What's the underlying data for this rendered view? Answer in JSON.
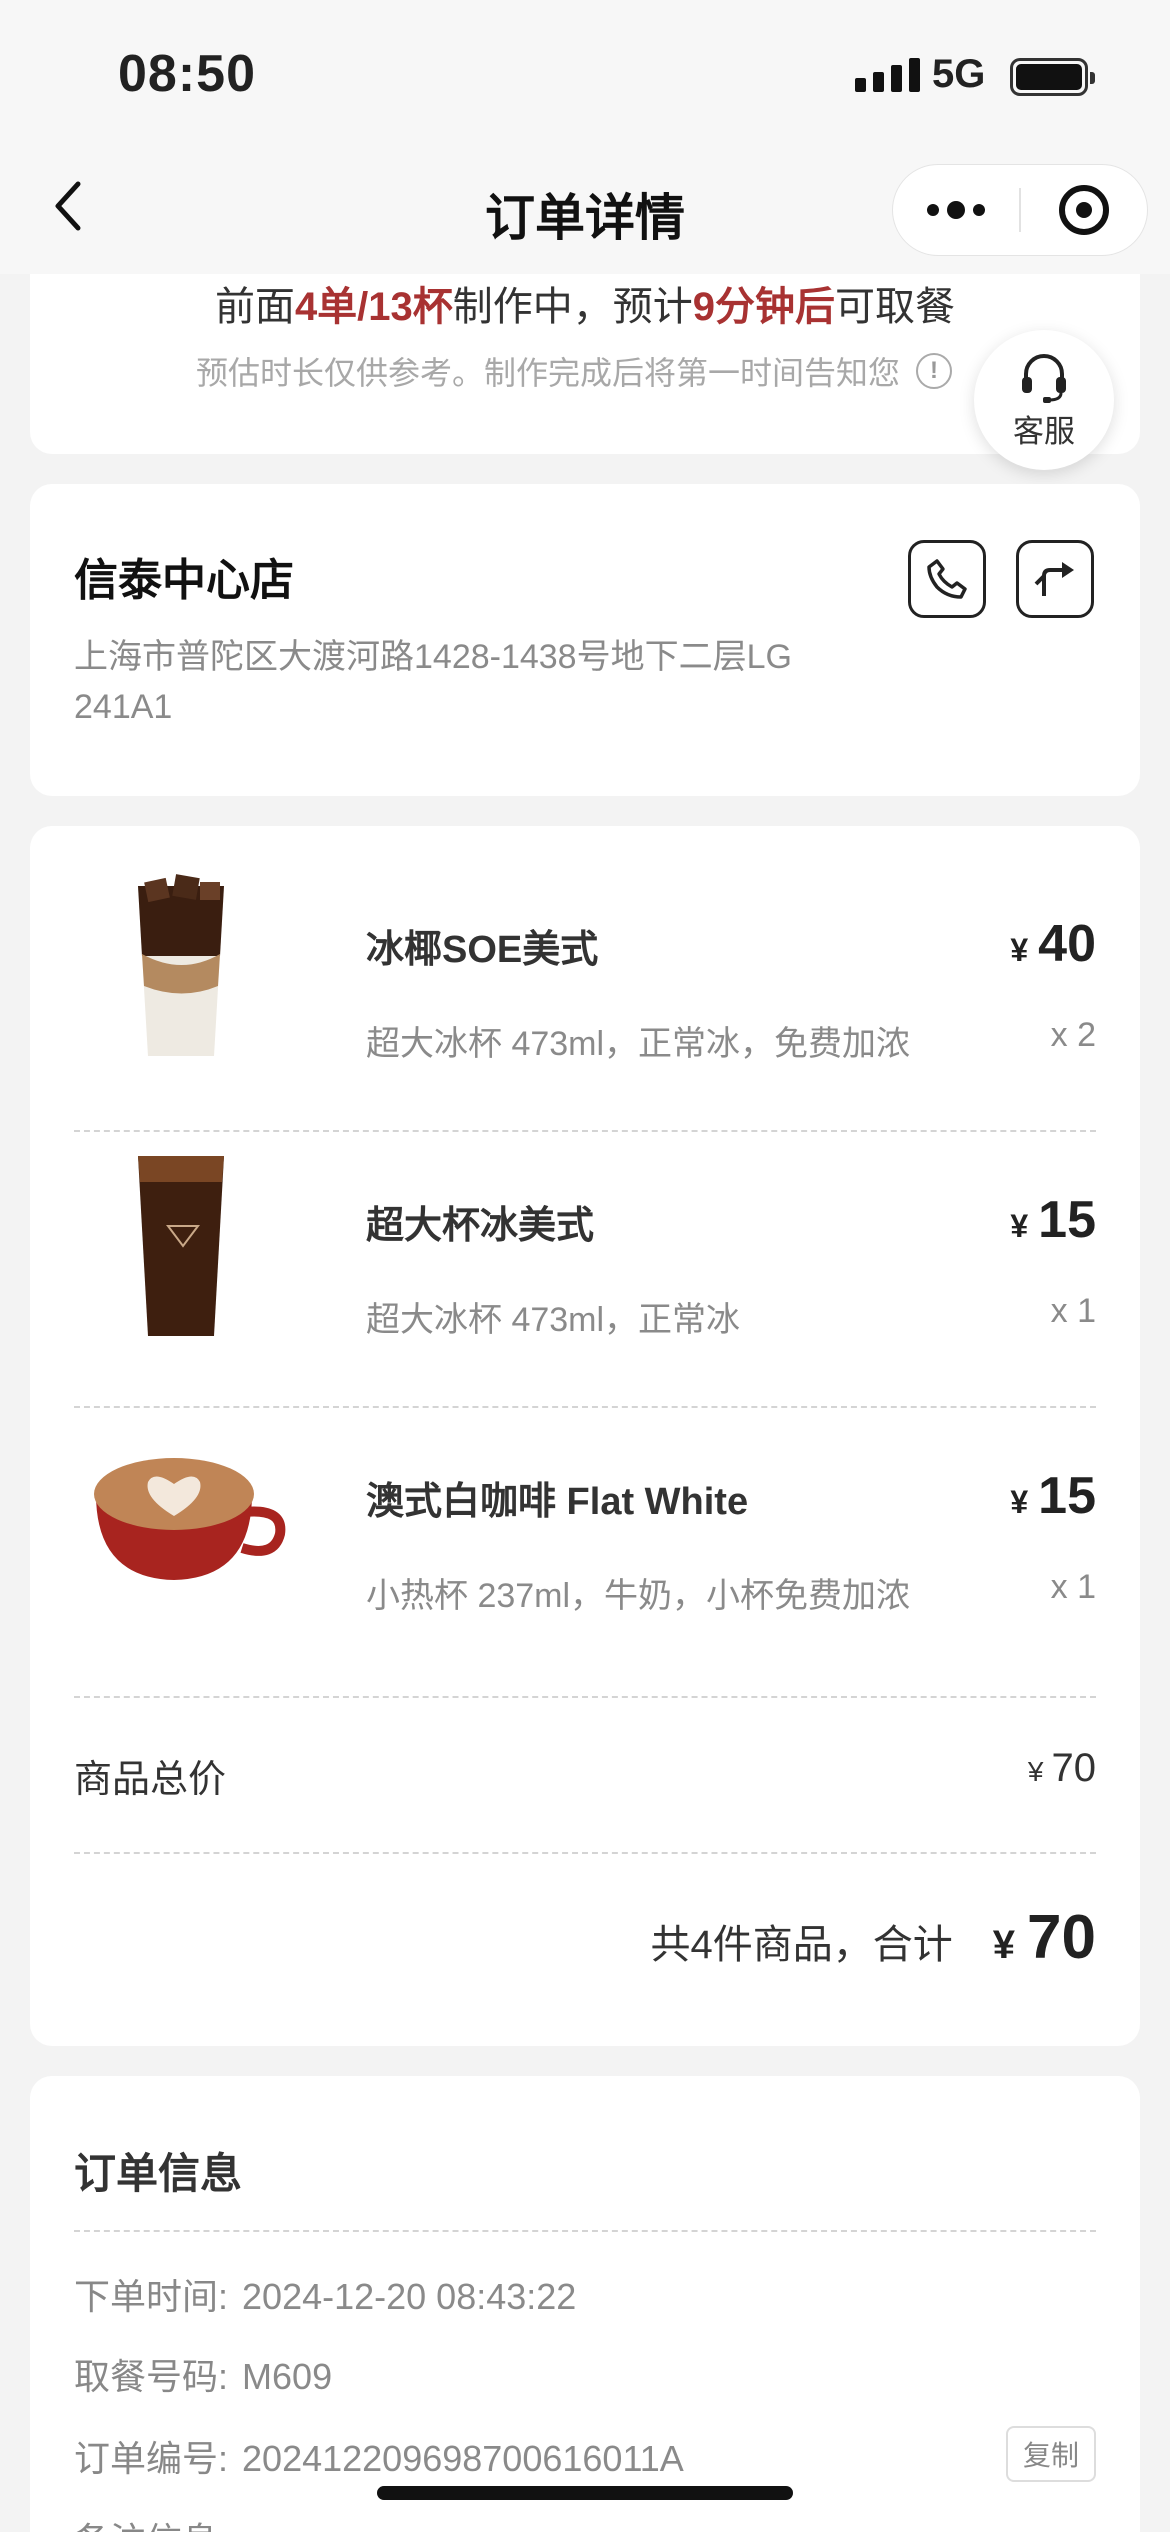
{
  "status_bar": {
    "time": "08:50",
    "network": "5G"
  },
  "nav": {
    "title": "订单详情"
  },
  "queue": {
    "prefix": "前面",
    "orders": "4单/13杯",
    "middle": "制作中，预计",
    "eta": "9分钟后",
    "suffix": "可取餐",
    "note": "预估时长仅供参考。制作完成后将第一时间告知您"
  },
  "service": {
    "label": "客服"
  },
  "store": {
    "name": "信泰中心店",
    "address": "上海市普陀区大渡河路1428-1438号地下二层LG 241A1"
  },
  "items": [
    {
      "name": "冰椰SOE美式",
      "spec": "超大冰杯 473ml，正常冰，免费加浓",
      "currency": "¥",
      "price": "40",
      "qty": "x 2"
    },
    {
      "name": "超大杯冰美式",
      "spec": "超大冰杯 473ml，正常冰",
      "currency": "¥",
      "price": "15",
      "qty": "x 1"
    },
    {
      "name": "澳式白咖啡 Flat White",
      "spec": "小热杯 237ml，牛奶，小杯免费加浓",
      "currency": "¥",
      "price": "15",
      "qty": "x 1"
    }
  ],
  "subtotal": {
    "label": "商品总价",
    "currency": "¥",
    "value": "70"
  },
  "total": {
    "text": "共4件商品，合计",
    "currency": "¥",
    "value": "70"
  },
  "order_info": {
    "title": "订单信息",
    "order_time_label": "下单时间:",
    "order_time": "2024-12-20 08:43:22",
    "pickup_code_label": "取餐号码:",
    "pickup_code": "M609",
    "order_no_label": "订单编号:",
    "order_no": "202412209698700616011A",
    "copy_label": "复制",
    "remark_label": "备注信息:"
  },
  "colors": {
    "highlight": "#a83232",
    "background": "#f3f3f3"
  }
}
